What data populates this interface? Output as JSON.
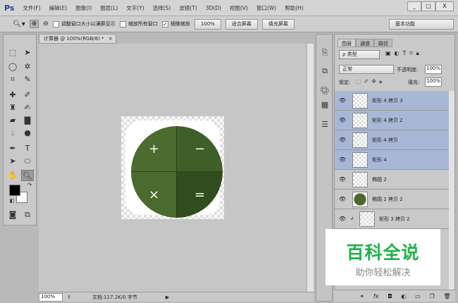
{
  "app": {
    "logo": "Ps",
    "menus": [
      "文件(F)",
      "编辑(E)",
      "图像(I)",
      "图层(L)",
      "文字(Y)",
      "选择(S)",
      "滤镜(T)",
      "3D(D)",
      "视图(V)",
      "窗口(W)",
      "帮助(H)"
    ],
    "minimize": "_",
    "maximize": "□",
    "close": "X"
  },
  "options": {
    "resize_windows": "调整窗口大小以满屏显示",
    "zoom_all": "缩放所有窗口",
    "scrubby_zoom": "细微缩放",
    "scrubby_check": "✓",
    "btn_100": "100%",
    "fit_screen": "适合屏幕",
    "fill_screen": "填充屏幕",
    "workspace": "基本功能"
  },
  "document": {
    "tab": "计算器 @ 100%(RGB/8) *",
    "close": "×",
    "buttons": [
      "+",
      "−",
      "×",
      "="
    ],
    "colors": [
      "#4b6b2f",
      "#3f5f28",
      "#4a6a2e",
      "#314c1e"
    ]
  },
  "status": {
    "zoom": "100%",
    "doc_info": "文档:117.2K/0 字节"
  },
  "layers_panel": {
    "tabs": [
      "图层",
      "通道",
      "路径"
    ],
    "filter": "ρ 类型",
    "blend_mode": "正常",
    "opacity_label": "不透明度:",
    "opacity": "100%",
    "lock_label": "锁定:",
    "fill_label": "填充:",
    "fill": "100%",
    "layers": [
      {
        "name": "矩形 4 拷贝 3",
        "selected": true
      },
      {
        "name": "矩形 4 拷贝 2",
        "selected": true
      },
      {
        "name": "矩形 4 拷贝",
        "selected": true
      },
      {
        "name": "矩形 4",
        "selected": true
      },
      {
        "name": "椭圆 2",
        "selected": false
      },
      {
        "name": "椭圆 2 拷贝 2",
        "selected": false
      },
      {
        "name": "矩形 3 拷贝 2",
        "selected": false
      }
    ]
  },
  "watermark": {
    "title": "百科全说",
    "subtitle": "助你轻松解决"
  }
}
